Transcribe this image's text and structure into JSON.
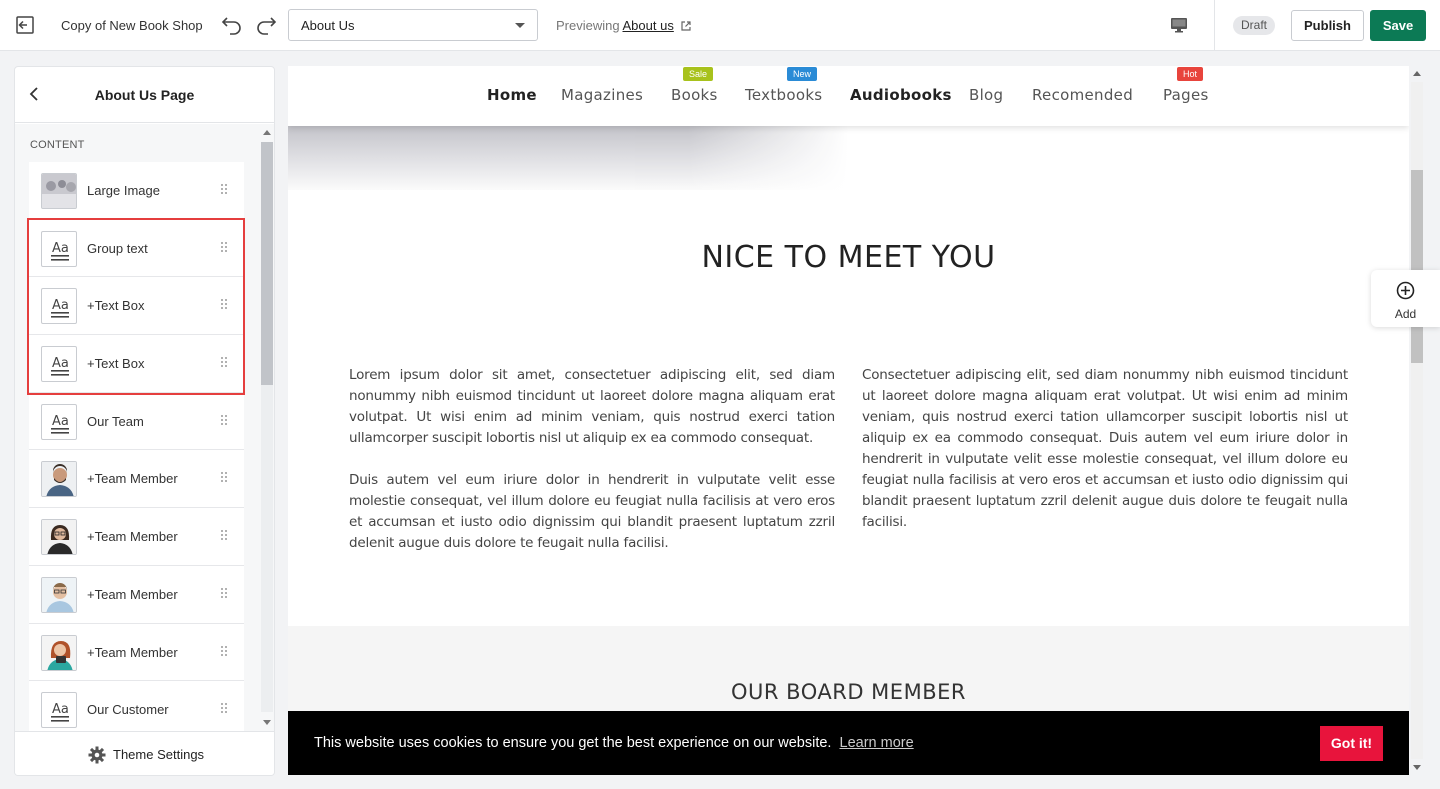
{
  "topbar": {
    "store_name": "Copy of New Book Shop",
    "page_select_value": "About Us",
    "previewing_label": "Previewing",
    "previewing_link": "About us",
    "status_badge": "Draft",
    "publish_label": "Publish",
    "save_label": "Save"
  },
  "sidebar": {
    "title": "About Us Page",
    "section_label": "CONTENT",
    "items": [
      {
        "label": "Large Image",
        "icon": "image-thumbnail"
      },
      {
        "label": "Group text",
        "icon": "text-icon"
      },
      {
        "label": "+Text Box",
        "icon": "text-icon"
      },
      {
        "label": "+Text Box",
        "icon": "text-icon"
      },
      {
        "label": "Our Team",
        "icon": "text-icon"
      },
      {
        "label": "+Team Member",
        "icon": "person-thumbnail"
      },
      {
        "label": "+Team Member",
        "icon": "person-thumbnail"
      },
      {
        "label": "+Team Member",
        "icon": "person-thumbnail"
      },
      {
        "label": "+Team Member",
        "icon": "person-thumbnail"
      },
      {
        "label": "Our Customer",
        "icon": "text-icon"
      }
    ],
    "footer_label": "Theme Settings"
  },
  "preview": {
    "nav": [
      {
        "label": "Home",
        "bold": true
      },
      {
        "label": "Magazines"
      },
      {
        "label": "Books",
        "badge": "Sale",
        "badge_color": "#a8c21c"
      },
      {
        "label": "Textbooks",
        "badge": "New",
        "badge_color": "#2a8bd6"
      },
      {
        "label": "Audiobooks",
        "bold": true
      },
      {
        "label": "Blog"
      },
      {
        "label": "Recomended"
      },
      {
        "label": "Pages",
        "badge": "Hot",
        "badge_color": "#e8443c"
      }
    ],
    "heading": "NICE TO MEET YOU",
    "paragraph_1": "Lorem ipsum dolor sit amet, consectetuer adipiscing elit, sed diam nonummy nibh euismod tincidunt ut laoreet dolore magna aliquam erat volutpat. Ut wisi enim ad minim veniam, quis nostrud exerci tation ullamcorper suscipit lobortis nisl ut aliquip ex ea commodo consequat.",
    "paragraph_2": "Duis autem vel eum iriure dolor in hendrerit in vulputate velit esse molestie consequat, vel illum dolore eu feugiat nulla facilisis at vero eros et accumsan et iusto odio dignissim qui blandit praesent luptatum zzril delenit augue duis dolore te feugait nulla facilisi.",
    "paragraph_3": "Consectetuer adipiscing elit, sed diam nonummy nibh euismod tincidunt ut laoreet dolore magna aliquam erat volutpat. Ut wisi enim ad minim veniam, quis nostrud exerci tation ullamcorper suscipit lobortis nisl ut aliquip ex ea commodo consequat. Duis autem vel eum iriure dolor in hendrerit in vulputate velit esse molestie consequat, vel illum dolore eu feugiat nulla facilisis at vero eros et accumsan et iusto odio dignissim qui blandit praesent luptatum zzril delenit augue duis dolore te feugait nulla facilisi.",
    "board_title": "OUR BOARD MEMBER",
    "cookie_message": "This website uses cookies to ensure you get the best experience on our website.",
    "cookie_learn_more": "Learn more",
    "cookie_button": "Got it!"
  },
  "add_panel_label": "Add",
  "colors": {
    "save": "#0c7a55",
    "highlight": "#e53e3e",
    "cookie_button": "#e8143c"
  }
}
